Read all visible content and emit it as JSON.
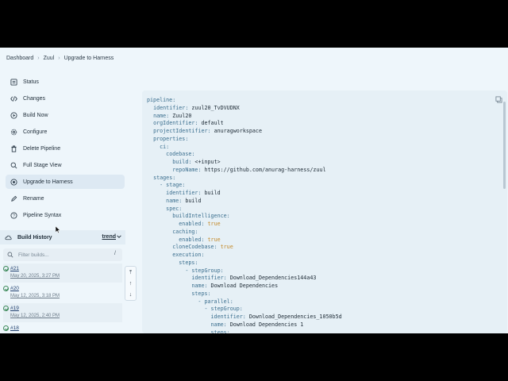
{
  "breadcrumb": [
    "Dashboard",
    "Zuul",
    "Upgrade to Harness"
  ],
  "nav": [
    {
      "label": "Status",
      "icon": "status-icon"
    },
    {
      "label": "Changes",
      "icon": "code-icon"
    },
    {
      "label": "Build Now",
      "icon": "play-icon"
    },
    {
      "label": "Configure",
      "icon": "gear-icon"
    },
    {
      "label": "Delete Pipeline",
      "icon": "trash-icon"
    },
    {
      "label": "Full Stage View",
      "icon": "search-icon"
    },
    {
      "label": "Upgrade to Harness",
      "icon": "harness-icon"
    },
    {
      "label": "Rename",
      "icon": "edit-icon"
    },
    {
      "label": "Pipeline Syntax",
      "icon": "help-icon"
    }
  ],
  "build_history": {
    "title": "Build History",
    "trend": "trend",
    "filter_placeholder": "Filter builds...",
    "filter_shortcut": "/",
    "builds": [
      {
        "num": "#21",
        "date": "May 20, 2025, 3:27 PM"
      },
      {
        "num": "#20",
        "date": "May 12, 2025, 3:18 PM"
      },
      {
        "num": "#19",
        "date": "May 12, 2025, 2:40 PM"
      },
      {
        "num": "#18",
        "date": ""
      }
    ]
  },
  "scroll_controls": [
    "⤒",
    "↑",
    "↓"
  ],
  "code_lines": [
    [
      0,
      "pipeline",
      ""
    ],
    [
      1,
      "identifier",
      "zuul20_TvDVUDNX"
    ],
    [
      1,
      "name",
      "Zuul20"
    ],
    [
      1,
      "orgIdentifier",
      "default"
    ],
    [
      1,
      "projectIdentifier",
      "anuragworkspace"
    ],
    [
      1,
      "properties",
      ""
    ],
    [
      2,
      "ci",
      ""
    ],
    [
      3,
      "codebase",
      ""
    ],
    [
      4,
      "build",
      "<+input>"
    ],
    [
      4,
      "repoName",
      "https://github.com/anurag-harness/zuul"
    ],
    [
      1,
      "stages",
      ""
    ],
    [
      2,
      "- stage",
      ""
    ],
    [
      3,
      "identifier",
      "build"
    ],
    [
      3,
      "name",
      "build"
    ],
    [
      3,
      "spec",
      ""
    ],
    [
      4,
      "buildIntelligence",
      ""
    ],
    [
      5,
      "enabled",
      "true"
    ],
    [
      4,
      "caching",
      ""
    ],
    [
      5,
      "enabled",
      "true"
    ],
    [
      4,
      "cloneCodebase",
      "true"
    ],
    [
      4,
      "execution",
      ""
    ],
    [
      5,
      "steps",
      ""
    ],
    [
      6,
      "- stepGroup",
      ""
    ],
    [
      7,
      "identifier",
      "Download_Dependencies144a43"
    ],
    [
      7,
      "name",
      "Download Dependencies"
    ],
    [
      7,
      "steps",
      ""
    ],
    [
      8,
      "- parallel",
      ""
    ],
    [
      9,
      "- stepGroup",
      ""
    ],
    [
      10,
      "identifier",
      "Download_Dependencies_1050b5d"
    ],
    [
      10,
      "name",
      "Download Dependencies 1"
    ],
    [
      10,
      "steps",
      ""
    ]
  ]
}
